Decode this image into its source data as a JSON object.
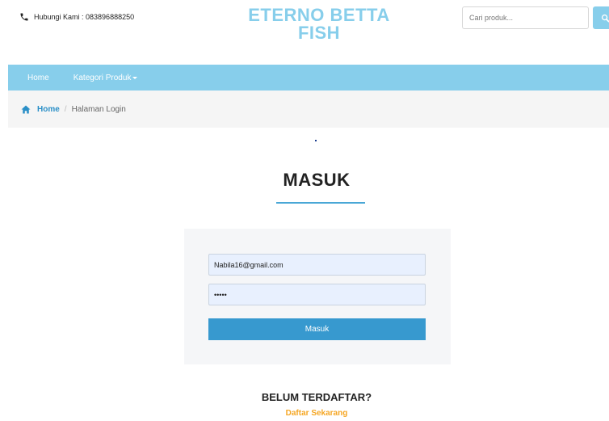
{
  "header": {
    "contact_text": "Hubungi Kami : 083896888250",
    "brand_line1": "ETERNO BETTA",
    "brand_line2": "FISH",
    "search_placeholder": "Cari produk..."
  },
  "nav": {
    "items": [
      {
        "label": "Home"
      },
      {
        "label": "Kategori Produk"
      }
    ]
  },
  "breadcrumb": {
    "home": "Home",
    "separator": "/",
    "current": "Halaman Login"
  },
  "login": {
    "title": "MASUK",
    "email_value": "Nabila16@gmail.com",
    "password_value": "•••••",
    "submit_label": "Masuk"
  },
  "register": {
    "title": "BELUM TERDAFTAR?",
    "link": "Daftar Sekarang"
  },
  "colors": {
    "brand": "#87ceeb",
    "nav_bg": "#87ceeb",
    "button": "#3799cf",
    "link_accent": "#f5a623"
  }
}
